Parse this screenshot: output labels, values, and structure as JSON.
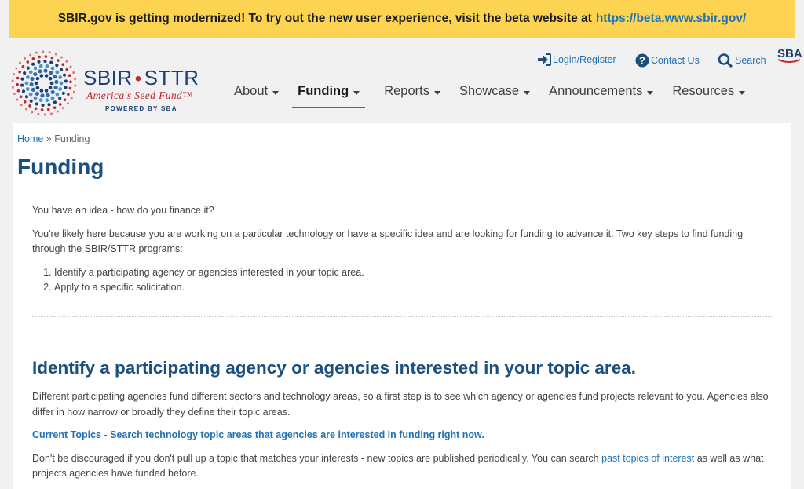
{
  "banner": {
    "text": "SBIR.gov is getting modernized! To try out the new user experience, visit the beta website at",
    "link": "https://beta.www.sbir.gov/"
  },
  "logo": {
    "title_left": "SBIR",
    "title_right": "STTR",
    "tagline": "America's Seed Fund™",
    "powered": "POWERED BY SBA",
    "sba": "SBA"
  },
  "utility_nav": {
    "login": "Login/Register",
    "contact": "Contact Us",
    "search": "Search"
  },
  "main_nav": [
    {
      "label": "About"
    },
    {
      "label": "Funding"
    },
    {
      "label": "Reports"
    },
    {
      "label": "Showcase"
    },
    {
      "label": "Announcements"
    },
    {
      "label": "Resources"
    }
  ],
  "breadcrumb": {
    "home": "Home",
    "separator": "»",
    "current": "Funding"
  },
  "page": {
    "title": "Funding",
    "intro_q": "You have an idea - how do you finance it?",
    "intro_p": "You're likely here because you are working on a particular technology or have a specific idea and are looking for funding to advance it. Two key steps to find funding through the SBIR/STTR programs:",
    "steps": [
      "Identify a participating agency or agencies interested in your topic area.",
      "Apply to a specific solicitation."
    ]
  },
  "section": {
    "title": "Identify a participating agency or agencies interested in your topic area.",
    "p1": "Different participating agencies fund different sectors and technology areas, so a first step is to see which agency or agencies fund projects relevant to you. Agencies also differ in how narrow or broadly they define their topic areas.",
    "topics_link": "Current Topics - Search technology topic areas that agencies are interested in funding right now.",
    "p2_a": "Don't be discouraged if you don't pull up a topic that matches your interests - new topics are published periodically. You can search",
    "p2_link": "past topics of interest",
    "p2_b": "as well as what projects agencies have funded before."
  },
  "colors": {
    "banner_bg": "#fdd451",
    "link": "#2072b8",
    "heading": "#1b4f80",
    "brand_red": "#c3262e"
  }
}
